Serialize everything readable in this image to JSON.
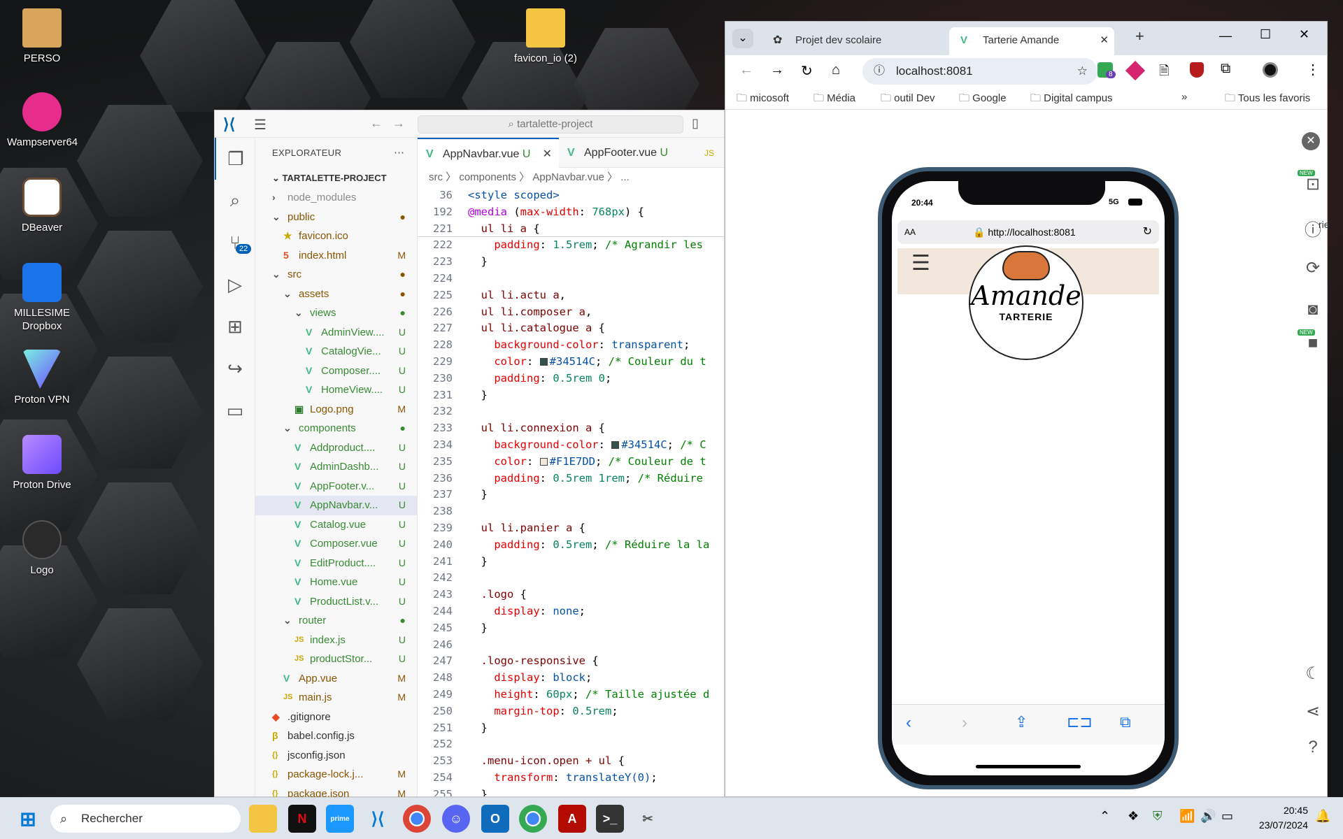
{
  "desktop": {
    "icons": [
      "PERSO",
      "Wampserver64",
      "DBeaver",
      "MILLESIME Dropbox",
      "Proton VPN",
      "Proton Drive",
      "Logo",
      "favicon_io (2)"
    ]
  },
  "vscode": {
    "search": "tartalette-project",
    "explorer_title": "EXPLORATEUR",
    "project": "TARTALETTE-PROJECT",
    "scm_badge": "22",
    "tree": [
      {
        "name": "node_modules",
        "indent": 1,
        "kind": "folder-closed",
        "status": "",
        "cls": "dim"
      },
      {
        "name": "public",
        "indent": 1,
        "kind": "folder-open",
        "status": "●",
        "cls": "m"
      },
      {
        "name": "favicon.ico",
        "indent": 2,
        "kind": "star",
        "status": "",
        "cls": "m"
      },
      {
        "name": "index.html",
        "indent": 2,
        "kind": "html",
        "status": "M",
        "cls": "m"
      },
      {
        "name": "src",
        "indent": 1,
        "kind": "folder-open",
        "status": "●",
        "cls": "m"
      },
      {
        "name": "assets",
        "indent": 2,
        "kind": "folder-open",
        "status": "●",
        "cls": "m"
      },
      {
        "name": "views",
        "indent": 3,
        "kind": "folder-open",
        "status": "●",
        "cls": "u"
      },
      {
        "name": "AdminView....",
        "indent": 4,
        "kind": "vue",
        "status": "U",
        "cls": "u"
      },
      {
        "name": "CatalogVie...",
        "indent": 4,
        "kind": "vue",
        "status": "U",
        "cls": "u"
      },
      {
        "name": "Composer....",
        "indent": 4,
        "kind": "vue",
        "status": "U",
        "cls": "u"
      },
      {
        "name": "HomeView....",
        "indent": 4,
        "kind": "vue",
        "status": "U",
        "cls": "u"
      },
      {
        "name": "Logo.png",
        "indent": 3,
        "kind": "img",
        "status": "M",
        "cls": "m"
      },
      {
        "name": "components",
        "indent": 2,
        "kind": "folder-open",
        "status": "●",
        "cls": "u"
      },
      {
        "name": "Addproduct....",
        "indent": 3,
        "kind": "vue",
        "status": "U",
        "cls": "u"
      },
      {
        "name": "AdminDashb...",
        "indent": 3,
        "kind": "vue",
        "status": "U",
        "cls": "u"
      },
      {
        "name": "AppFooter.v...",
        "indent": 3,
        "kind": "vue",
        "status": "U",
        "cls": "u"
      },
      {
        "name": "AppNavbar.v...",
        "indent": 3,
        "kind": "vue",
        "status": "U",
        "cls": "u",
        "selected": true
      },
      {
        "name": "Catalog.vue",
        "indent": 3,
        "kind": "vue",
        "status": "U",
        "cls": "u"
      },
      {
        "name": "Composer.vue",
        "indent": 3,
        "kind": "vue",
        "status": "U",
        "cls": "u"
      },
      {
        "name": "EditProduct....",
        "indent": 3,
        "kind": "vue",
        "status": "U",
        "cls": "u"
      },
      {
        "name": "Home.vue",
        "indent": 3,
        "kind": "vue",
        "status": "U",
        "cls": "u"
      },
      {
        "name": "ProductList.v...",
        "indent": 3,
        "kind": "vue",
        "status": "U",
        "cls": "u"
      },
      {
        "name": "router",
        "indent": 2,
        "kind": "folder-open",
        "status": "●",
        "cls": "u"
      },
      {
        "name": "index.js",
        "indent": 3,
        "kind": "js",
        "status": "U",
        "cls": "u"
      },
      {
        "name": "productStor...",
        "indent": 3,
        "kind": "js",
        "status": "U",
        "cls": "u"
      },
      {
        "name": "App.vue",
        "indent": 2,
        "kind": "vue",
        "status": "M",
        "cls": "m"
      },
      {
        "name": "main.js",
        "indent": 2,
        "kind": "js",
        "status": "M",
        "cls": "m"
      },
      {
        "name": ".gitignore",
        "indent": 1,
        "kind": "git",
        "status": "",
        "cls": ""
      },
      {
        "name": "babel.config.js",
        "indent": 1,
        "kind": "babel",
        "status": "",
        "cls": ""
      },
      {
        "name": "jsconfig.json",
        "indent": 1,
        "kind": "json",
        "status": "",
        "cls": ""
      },
      {
        "name": "package-lock.j...",
        "indent": 1,
        "kind": "json",
        "status": "M",
        "cls": "m"
      },
      {
        "name": "package.json",
        "indent": 1,
        "kind": "json",
        "status": "M",
        "cls": "m"
      }
    ],
    "tabs": [
      {
        "name": "AppNavbar.vue",
        "status": "U",
        "active": true
      },
      {
        "name": "AppFooter.vue",
        "status": "U",
        "active": false
      }
    ],
    "breadcrumb": "src 〉 components 〉 AppNavbar.vue 〉 ...",
    "code": [
      {
        "n": "36",
        "html": "<span class='str'>&lt;style scoped&gt;</span>"
      },
      {
        "n": "192",
        "html": "<span class='kw'>@media</span> (<span class='prop'>max-width</span>: <span class='val'>768px</span>) {"
      },
      {
        "n": "221",
        "html": "  <span class='sel-c'>ul li a</span> {"
      },
      {
        "n": "222",
        "html": "    <span class='prop'>padding</span>: <span class='val'>1.5rem</span>; <span class='cm'>/* Agrandir les</span>"
      },
      {
        "n": "223",
        "html": "  }"
      },
      {
        "n": "224",
        "html": ""
      },
      {
        "n": "225",
        "html": "  <span class='sel-c'>ul li.actu a</span>,"
      },
      {
        "n": "226",
        "html": "  <span class='sel-c'>ul li.composer a</span>,"
      },
      {
        "n": "227",
        "html": "  <span class='sel-c'>ul li.catalogue a</span> {"
      },
      {
        "n": "228",
        "html": "    <span class='prop'>background-color</span>: <span class='str'>transparent</span>;"
      },
      {
        "n": "229",
        "html": "    <span class='prop'>color</span>: <span class='sw' style='background:#34514C'></span><span class='str'>#34514C</span>; <span class='cm'>/* Couleur du t</span>"
      },
      {
        "n": "230",
        "html": "    <span class='prop'>padding</span>: <span class='val'>0.5rem 0</span>;"
      },
      {
        "n": "231",
        "html": "  }"
      },
      {
        "n": "232",
        "html": ""
      },
      {
        "n": "233",
        "html": "  <span class='sel-c'>ul li.connexion a</span> {"
      },
      {
        "n": "234",
        "html": "    <span class='prop'>background-color</span>: <span class='sw' style='background:#34514C'></span><span class='str'>#34514C</span>; <span class='cm'>/* C</span>"
      },
      {
        "n": "235",
        "html": "    <span class='prop'>color</span>: <span class='sw' style='background:#F1E7DD'></span><span class='str'>#F1E7DD</span>; <span class='cm'>/* Couleur de t</span>"
      },
      {
        "n": "236",
        "html": "    <span class='prop'>padding</span>: <span class='val'>0.5rem 1rem</span>; <span class='cm'>/* Réduire</span>"
      },
      {
        "n": "237",
        "html": "  }"
      },
      {
        "n": "238",
        "html": ""
      },
      {
        "n": "239",
        "html": "  <span class='sel-c'>ul li.panier a</span> {"
      },
      {
        "n": "240",
        "html": "    <span class='prop'>padding</span>: <span class='val'>0.5rem</span>; <span class='cm'>/* Réduire la la</span>"
      },
      {
        "n": "241",
        "html": "  }"
      },
      {
        "n": "242",
        "html": ""
      },
      {
        "n": "243",
        "html": "  <span class='sel-c'>.logo</span> {"
      },
      {
        "n": "244",
        "html": "    <span class='prop'>display</span>: <span class='str'>none</span>;"
      },
      {
        "n": "245",
        "html": "  }"
      },
      {
        "n": "246",
        "html": ""
      },
      {
        "n": "247",
        "html": "  <span class='sel-c'>.logo-responsive</span> {"
      },
      {
        "n": "248",
        "html": "    <span class='prop'>display</span>: <span class='str'>block</span>;"
      },
      {
        "n": "249",
        "html": "    <span class='prop'>height</span>: <span class='val'>60px</span>; <span class='cm'>/* Taille ajustée d</span>"
      },
      {
        "n": "250",
        "html": "    <span class='prop'>margin-top</span>: <span class='val'>0.5rem</span>;"
      },
      {
        "n": "251",
        "html": "  }"
      },
      {
        "n": "252",
        "html": ""
      },
      {
        "n": "253",
        "html": "  <span class='sel-c'>.menu-icon.open + ul</span> {"
      },
      {
        "n": "254",
        "html": "    <span class='prop'>transform</span>: <span class='str'>translateY(0)</span>;"
      },
      {
        "n": "255",
        "html": "  }"
      }
    ]
  },
  "chrome": {
    "tab1": "Projet dev scolaire technolo",
    "tab2": "Tarterie Amande",
    "url": "localhost:8081",
    "ext_badge": "8",
    "bookmarks": [
      "micosoft",
      "Média",
      "outil Dev",
      "Google",
      "Digital campus"
    ],
    "all_bookmarks": "Tous les favoris",
    "phone": {
      "time": "20:44",
      "network": "5G",
      "aa": "AA",
      "url": "http://localhost:8081",
      "logo_text": "Amande",
      "logo_sub": "TARTERIE"
    },
    "side_new1": "NEW",
    "side_new2": "NEW",
    "edge_text": "rie"
  },
  "taskbar": {
    "search": "Rechercher",
    "time": "20:45",
    "date": "23/07/2024"
  }
}
